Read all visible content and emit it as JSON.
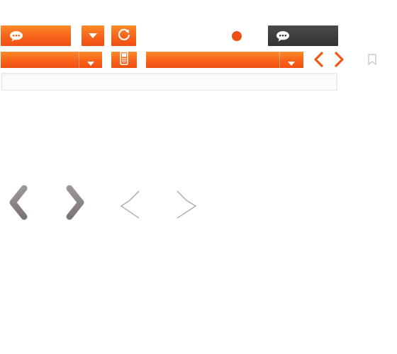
{
  "toolbar": {
    "comment_button_label": "",
    "dropdown_button_label": "",
    "refresh_button_label": "",
    "dark_comment_button_label": "",
    "status_indicator": {
      "color": "#ee4f12"
    }
  },
  "filters": {
    "select_left_value": "",
    "device_button_label": "",
    "select_right_value": "",
    "prev_arrow": "chevron-left-icon",
    "next_arrow": "chevron-right-icon",
    "bookmark": "bookmark-icon"
  },
  "search": {
    "placeholder": "",
    "value": ""
  },
  "gallery_controls": {
    "large_prev": "chevron-left-icon",
    "large_next": "chevron-right-icon",
    "thin_prev": "chevron-left-thin-icon",
    "thin_next": "chevron-right-thin-icon"
  },
  "colors": {
    "accent": "#f7621a",
    "dark": "#3a3a3a",
    "chevron_gray": "#8f8785",
    "thin_chevron_gray": "#a4a4a4"
  }
}
